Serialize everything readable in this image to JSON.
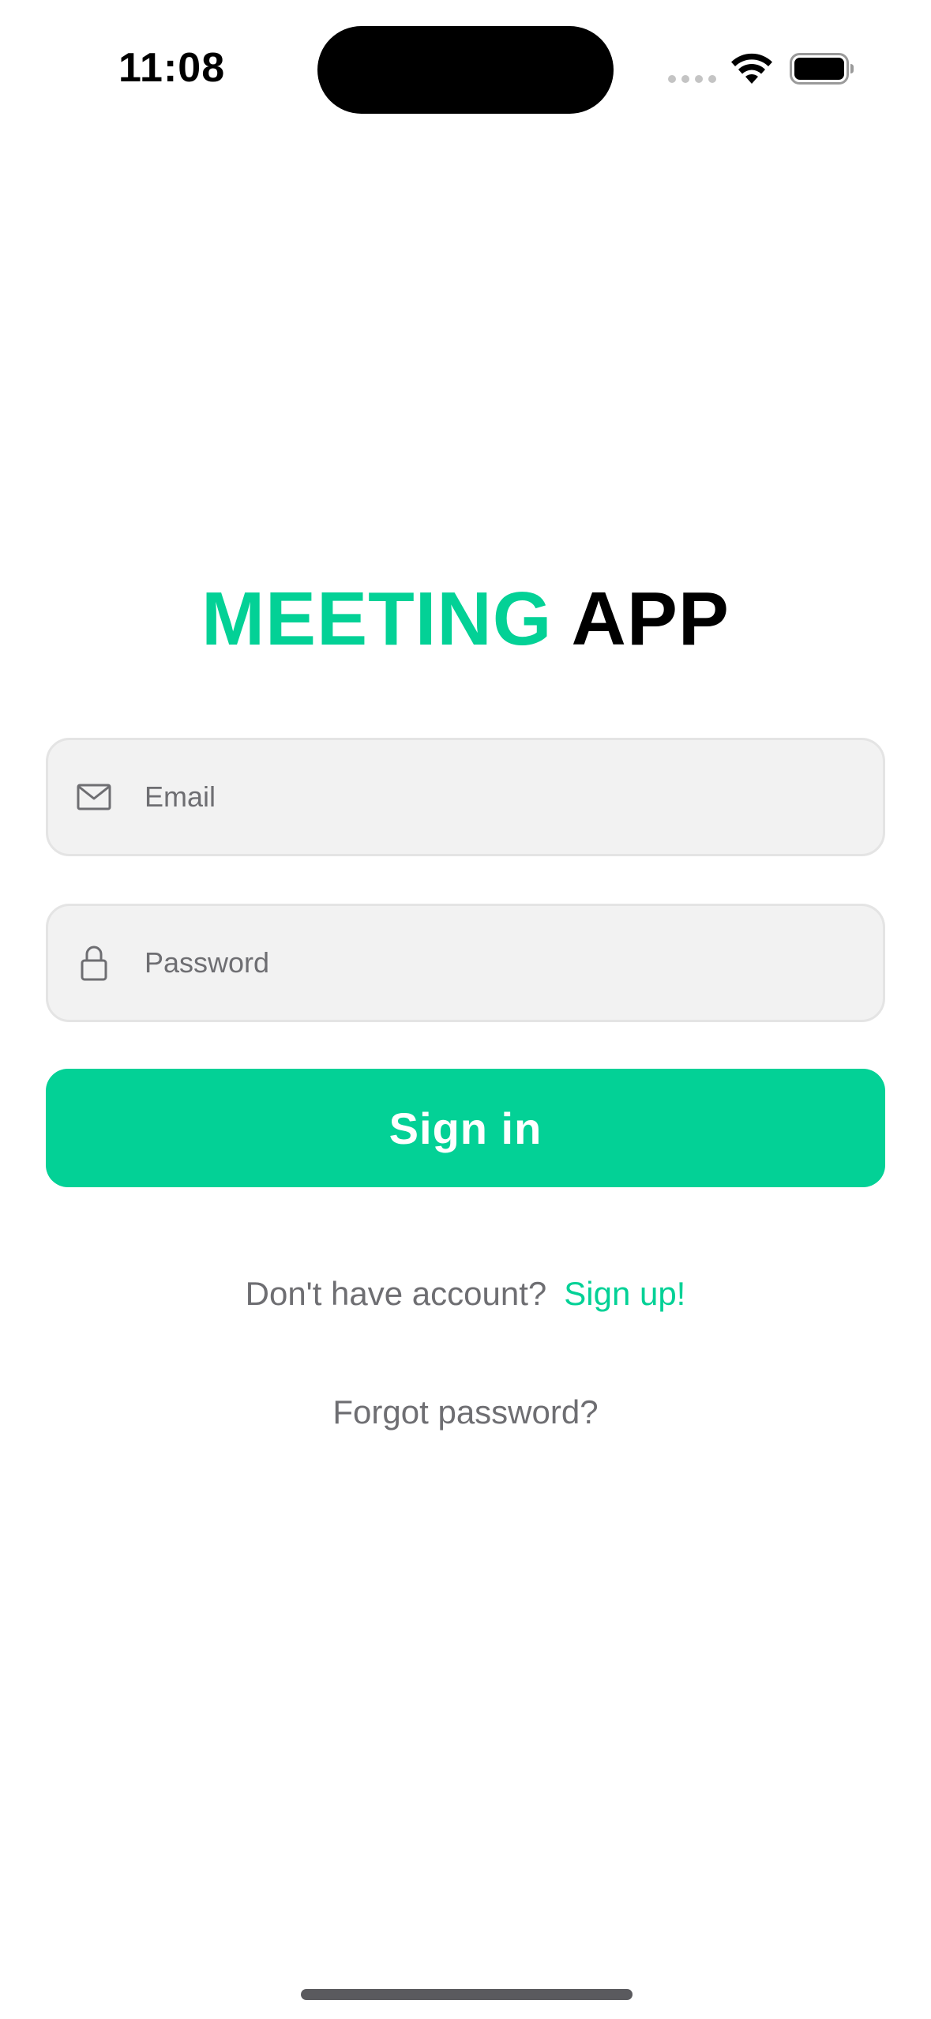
{
  "status_bar": {
    "time": "11:08"
  },
  "title": {
    "accent_word": "MEETING",
    "dark_word": "APP"
  },
  "form": {
    "email_placeholder": "Email",
    "email_value": "",
    "password_placeholder": "Password",
    "password_value": "",
    "signin_label": "Sign in"
  },
  "footer": {
    "signup_prompt": "Don't have account?",
    "signup_link": "Sign up!",
    "forgot_password": "Forgot password?"
  },
  "icons": {
    "email_field": "envelope-icon",
    "password_field": "lock-icon",
    "wifi": "wifi-icon",
    "battery": "battery-icon"
  },
  "colors": {
    "accent": "#03d196",
    "field_background": "#f2f2f2",
    "muted_text": "#6e6e72"
  }
}
